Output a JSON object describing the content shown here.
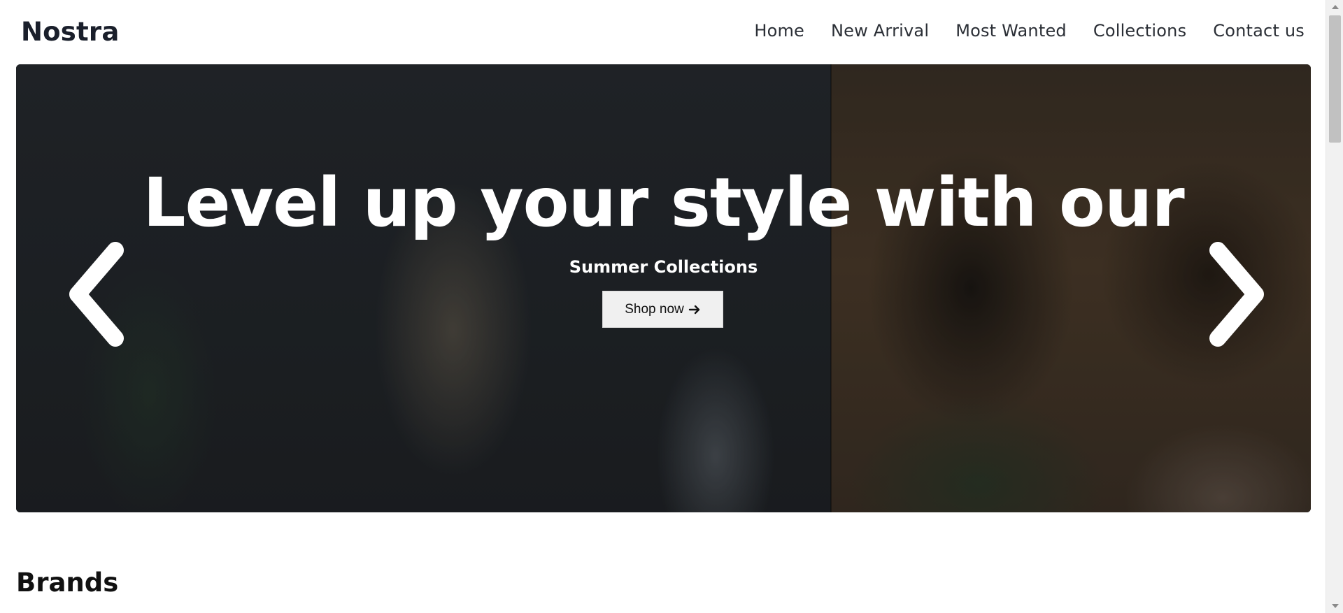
{
  "header": {
    "brand": "Nostra",
    "nav": [
      {
        "label": "Home"
      },
      {
        "label": "New Arrival"
      },
      {
        "label": "Most Wanted"
      },
      {
        "label": "Collections"
      },
      {
        "label": "Contact us"
      }
    ]
  },
  "hero": {
    "title": "Level up your style with our",
    "subtitle": "Summer Collections",
    "cta_label": "Shop now",
    "cta_icon": "arrow-right-icon",
    "prev_icon": "chevron-left-icon",
    "next_icon": "chevron-right-icon"
  },
  "brands": {
    "title": "Brands"
  },
  "colors": {
    "text_dark": "#1a1f2b",
    "hero_bg": "#1f2226",
    "button_bg": "#f0f0f0",
    "scrollbar_thumb": "#c1c1c1"
  }
}
